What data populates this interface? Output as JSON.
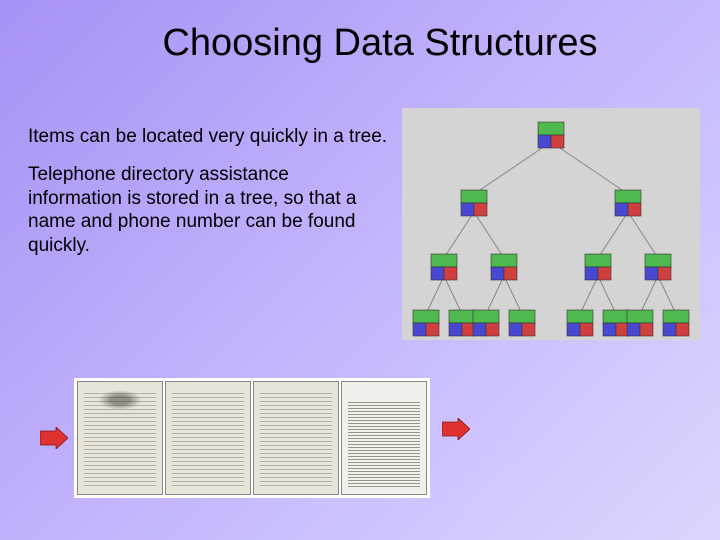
{
  "title": "Choosing Data Structures",
  "paragraphs": [
    "Items can be located very quickly in a tree.",
    "Telephone directory assistance information is stored in a tree, so that a name and phone number can be found quickly."
  ],
  "icons": {
    "arrow_color": "#e03030",
    "tree_node_colors": {
      "top": "#4fb84f",
      "bl": "#4848d0",
      "br": "#d04040"
    }
  }
}
